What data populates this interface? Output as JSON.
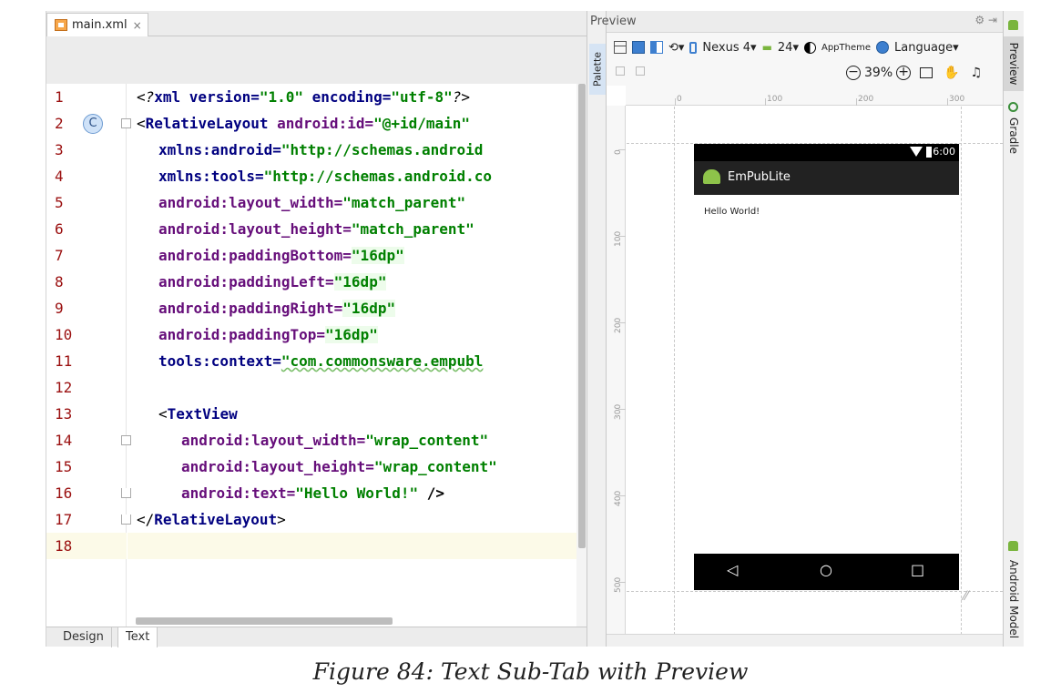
{
  "editor": {
    "file_tab": "main.xml",
    "bottom_tabs": {
      "design": "Design",
      "text": "Text"
    },
    "line_numbers": [
      "1",
      "2",
      "3",
      "4",
      "5",
      "6",
      "7",
      "8",
      "9",
      "10",
      "11",
      "12",
      "13",
      "14",
      "15",
      "16",
      "17",
      "18"
    ],
    "lines": {
      "l1_a": "<?",
      "l1_b": "xml version=",
      "l1_c": "\"1.0\"",
      "l1_d": " encoding=",
      "l1_e": "\"utf-8\"",
      "l1_f": "?>",
      "l2_a": "<",
      "l2_b": "RelativeLayout",
      "l2_c": " android:id=",
      "l2_d": "\"@+id/main\"",
      "l3_a": "xmlns:android=",
      "l3_b": "\"http://schemas.android",
      "l4_a": "xmlns:tools=",
      "l4_b": "\"http://schemas.android.co",
      "l5_a": "android:layout_width=",
      "l5_b": "\"match_parent\"",
      "l6_a": "android:layout_height=",
      "l6_b": "\"match_parent\"",
      "l7_a": "android:paddingBottom=",
      "l7_b": "\"16dp\"",
      "l8_a": "android:paddingLeft=",
      "l8_b": "\"16dp\"",
      "l9_a": "android:paddingRight=",
      "l9_b": "\"16dp\"",
      "l10_a": "android:paddingTop=",
      "l10_b": "\"16dp\"",
      "l11_a": "tools:context=",
      "l11_b": "\"com.commonsware.empubl",
      "l13_a": "<",
      "l13_b": "TextView",
      "l14_a": "android:layout_width=",
      "l14_b": "\"wrap_content\"",
      "l15_a": "android:layout_height=",
      "l15_b": "\"wrap_content\"",
      "l16_a": "android:text=",
      "l16_b": "\"Hello World!\"",
      "l16_c": " />",
      "l17_a": "</",
      "l17_b": "RelativeLayout",
      "l17_c": ">"
    },
    "c_badge": "C"
  },
  "palette": {
    "label": "Palette"
  },
  "preview": {
    "title": "Preview",
    "toolbar": {
      "device": "Nexus 4",
      "api": "24",
      "theme": "AppTheme",
      "language": "Language"
    },
    "zoom": "39%",
    "ruler_h": [
      "0",
      "100",
      "200",
      "300"
    ],
    "ruler_v": [
      "0",
      "100",
      "200",
      "300",
      "400",
      "500"
    ],
    "device_screen": {
      "time": "6:00",
      "app_title": "EmPubLite",
      "hello": "Hello World!",
      "nav": {
        "back": "◁",
        "home": "○",
        "recents": "□"
      }
    }
  },
  "right_strip": {
    "preview": "Preview",
    "gradle": "Gradle",
    "android_model": "Android Model"
  },
  "caption": "Figure 84: Text Sub-Tab with Preview",
  "colors": {
    "tag": "#000080",
    "attr": "#660e7a",
    "string": "#008000",
    "line_number": "#9a0f0f"
  }
}
